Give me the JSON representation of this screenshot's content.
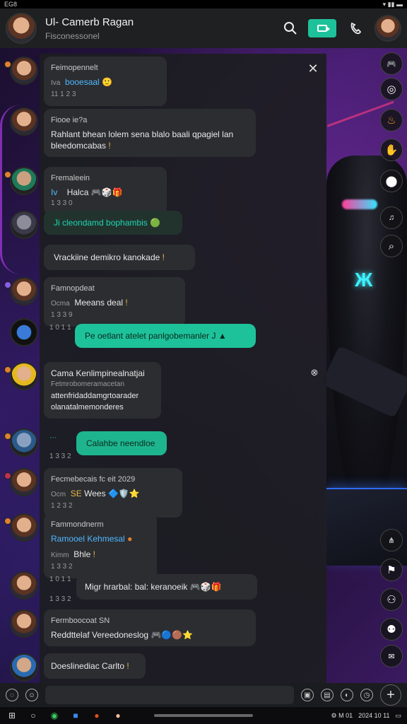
{
  "status_bar": {
    "left": "EG8"
  },
  "header": {
    "title": "Ul- Camerb Ragan",
    "subtitle": "Fisconessonel"
  },
  "messages": [
    {
      "name": "Feimopennelt",
      "time": "11 1 2 3",
      "text": "booesaal",
      "emoji": "🙂"
    },
    {
      "name": "Fiooe ie?a",
      "text": "Rahlant bhean lolem sena blalo baali qpagiel lan bleedomcabas",
      "emoji": "!"
    },
    {
      "name": "Fremaleein",
      "time": "1 3 3 0",
      "text": "Halca",
      "emoji": "🎮🎲🎁"
    },
    {
      "text": "Ji cleondamd bophambis",
      "emoji": "🟢"
    },
    {
      "text": "Vrackiine demikro kanokade",
      "emoji": "!"
    },
    {
      "name": "Famnopdeat",
      "sender": "Ocma",
      "text": "Meeans deal",
      "time": "1 3 3 9",
      "emoji": "!"
    },
    {
      "time": "1 0 1 1",
      "text": "Pe oetlant atelet panlgobemanler J",
      "emoji": "▲"
    },
    {
      "title": "Cama Kenlimpinealnatjai",
      "line1": "Fetmrobomeramacetan",
      "line2": "attenfridaddamgrtoarader",
      "line3": "olanatalmemonderes"
    },
    {
      "time": "1 3 3 2",
      "text": "Calahbe neendloe"
    },
    {
      "name": "Fecmebecais fc eit 2029",
      "sender": "Ocm",
      "text": "Wees",
      "time": "1 2 3 2",
      "emoji": "🔷🛡️⭐"
    },
    {
      "name": "Fammondnerm",
      "text": "Ramooel Kehmesal",
      "sender": "Kimm",
      "text2": "Bhle",
      "time": "1 3 3 2"
    },
    {
      "time": "1 0 1 1",
      "text": "Migr hrarbal: bal: keranoeik",
      "emoji": "🎮🎲🎁",
      "time2": "1 3 3 2"
    },
    {
      "name": "Fermboocoat SN",
      "text": "Reddttelaf Vereedoneslog",
      "emoji": "🎮🔵🟤⭐"
    },
    {
      "text": "Doeslinediac Carlto",
      "emoji": "!"
    }
  ],
  "input": {
    "placeholder": ""
  },
  "taskbar": {
    "tray_left": "⚙ M 01",
    "tray_right": "2024 10 11"
  },
  "colors": {
    "accent": "#1ec29a",
    "link": "#4fb8ff",
    "panel": "#1c1d21"
  }
}
